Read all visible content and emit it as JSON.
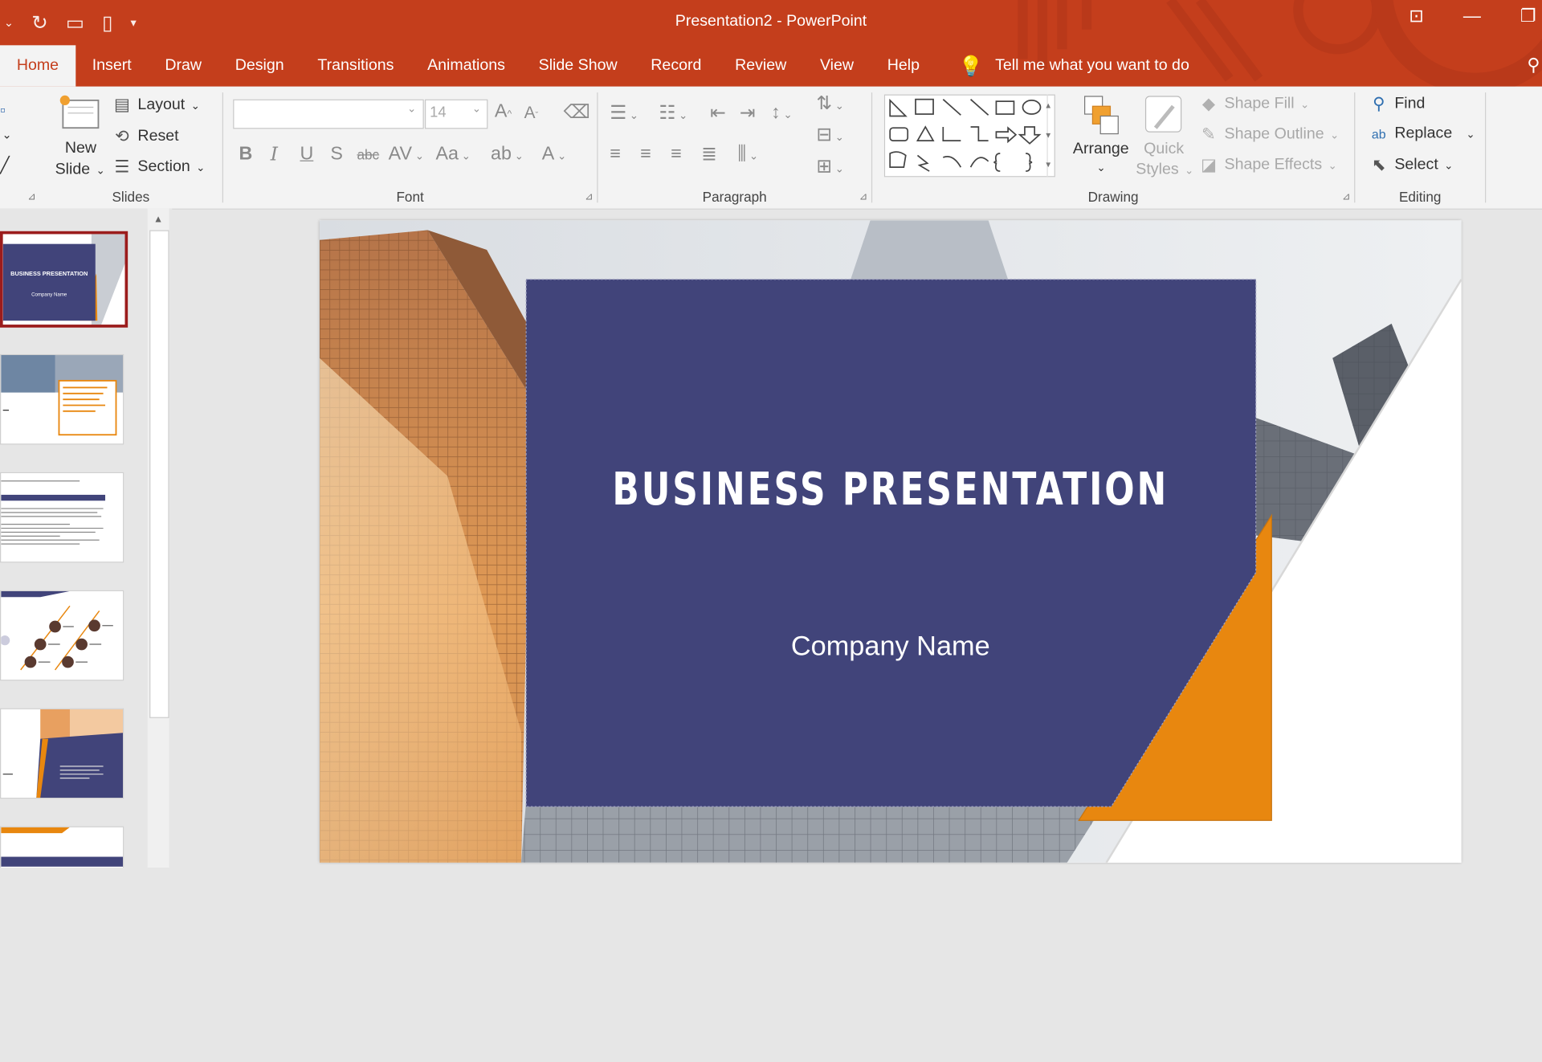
{
  "window": {
    "title": "Presentation2  -  PowerPoint"
  },
  "tabs": [
    "Home",
    "Insert",
    "Draw",
    "Design",
    "Transitions",
    "Animations",
    "Slide Show",
    "Record",
    "Review",
    "View",
    "Help"
  ],
  "tell_me": "Tell me what you want to do",
  "ribbon": {
    "slides": {
      "new_slide_1": "New",
      "new_slide_2": "Slide",
      "layout": "Layout",
      "reset": "Reset",
      "section": "Section",
      "label": "Slides"
    },
    "font": {
      "size": "14",
      "label": "Font"
    },
    "paragraph": {
      "label": "Paragraph"
    },
    "drawing": {
      "arrange": "Arrange",
      "quick_styles_1": "Quick",
      "quick_styles_2": "Styles",
      "shape_fill": "Shape Fill",
      "shape_outline": "Shape Outline",
      "shape_effects": "Shape Effects",
      "label": "Drawing"
    },
    "editing": {
      "find": "Find",
      "replace": "Replace",
      "select": "Select",
      "label": "Editing"
    }
  },
  "slide": {
    "title": "BUSINESS PRESENTATION",
    "subtitle": "Company Name"
  },
  "thumbnails": {
    "t1_title": "BUSINESS PRESENTATION",
    "t1_sub": "Company Name"
  },
  "colors": {
    "accent": "#c43e1c",
    "slide_panel": "#41447a",
    "slide_orange": "#e8870f"
  }
}
